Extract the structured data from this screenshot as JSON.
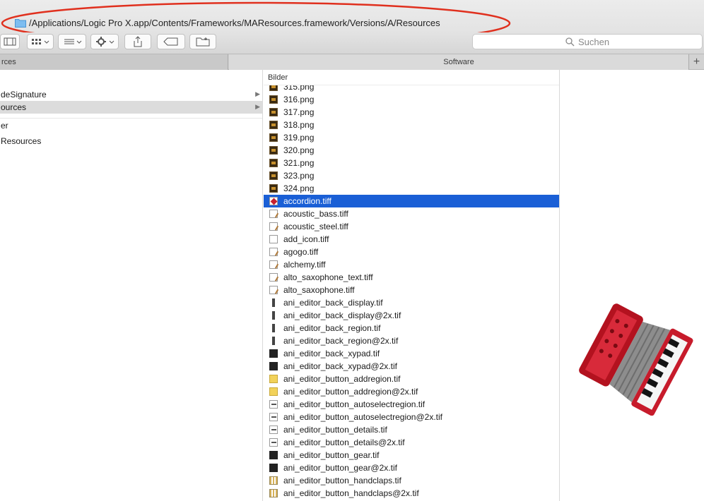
{
  "path": {
    "text": "/Applications/Logic Pro X.app/Contents/Frameworks/MAResources.framework/Versions/A/Resources",
    "icon": "folder-icon"
  },
  "toolbar": {
    "buttons": [
      "sidebar-icon",
      "grid-view-icon",
      "list-view-icon",
      "gear-icon",
      "share-icon",
      "tag-icon",
      "new-folder-icon"
    ],
    "search_placeholder": "Suchen"
  },
  "tabs": {
    "left": "rces",
    "right": "Software",
    "add": "+"
  },
  "column1": {
    "items": [
      {
        "label": "deSignature",
        "arrow": "▶",
        "selected": false
      },
      {
        "label": "ources",
        "arrow": "▶",
        "selected": true
      },
      {
        "label": "er",
        "arrow": "",
        "selected": false
      },
      {
        "label": "Resources",
        "arrow": "",
        "selected": false
      }
    ]
  },
  "column2": {
    "header": "Bilder",
    "files": [
      {
        "name": "315.png",
        "icon": "dark"
      },
      {
        "name": "316.png",
        "icon": "dark"
      },
      {
        "name": "317.png",
        "icon": "dark"
      },
      {
        "name": "318.png",
        "icon": "dark"
      },
      {
        "name": "319.png",
        "icon": "dark"
      },
      {
        "name": "320.png",
        "icon": "dark"
      },
      {
        "name": "321.png",
        "icon": "dark"
      },
      {
        "name": "323.png",
        "icon": "dark"
      },
      {
        "name": "324.png",
        "icon": "dark"
      },
      {
        "name": "accordion.tiff",
        "icon": "red",
        "selected": true
      },
      {
        "name": "acoustic_bass.tiff",
        "icon": "instr"
      },
      {
        "name": "acoustic_steel.tiff",
        "icon": "instr"
      },
      {
        "name": "add_icon.tiff",
        "icon": "blank"
      },
      {
        "name": "agogo.tiff",
        "icon": "instr"
      },
      {
        "name": "alchemy.tiff",
        "icon": "instr"
      },
      {
        "name": "alto_saxophone_text.tiff",
        "icon": "instr"
      },
      {
        "name": "alto_saxophone.tiff",
        "icon": "instr"
      },
      {
        "name": "ani_editor_back_display.tif",
        "icon": "bar"
      },
      {
        "name": "ani_editor_back_display@2x.tif",
        "icon": "bar"
      },
      {
        "name": "ani_editor_back_region.tif",
        "icon": "bar"
      },
      {
        "name": "ani_editor_back_region@2x.tif",
        "icon": "bar"
      },
      {
        "name": "ani_editor_back_xypad.tif",
        "icon": "black"
      },
      {
        "name": "ani_editor_back_xypad@2x.tif",
        "icon": "black"
      },
      {
        "name": "ani_editor_button_addregion.tif",
        "icon": "yellow"
      },
      {
        "name": "ani_editor_button_addregion@2x.tif",
        "icon": "yellow"
      },
      {
        "name": "ani_editor_button_autoselectregion.tif",
        "icon": "light"
      },
      {
        "name": "ani_editor_button_autoselectregion@2x.tif",
        "icon": "light"
      },
      {
        "name": "ani_editor_button_details.tif",
        "icon": "light"
      },
      {
        "name": "ani_editor_button_details@2x.tif",
        "icon": "light"
      },
      {
        "name": "ani_editor_button_gear.tif",
        "icon": "black"
      },
      {
        "name": "ani_editor_button_gear@2x.tif",
        "icon": "black"
      },
      {
        "name": "ani_editor_button_handclaps.tif",
        "icon": "grid"
      },
      {
        "name": "ani_editor_button_handclaps@2x.tif",
        "icon": "grid"
      }
    ]
  },
  "preview": {
    "icon": "accordion-icon"
  },
  "colors": {
    "selection": "#1a5fd6",
    "annotation_oval": "#e0301e",
    "folder": "#5aa9e6"
  }
}
